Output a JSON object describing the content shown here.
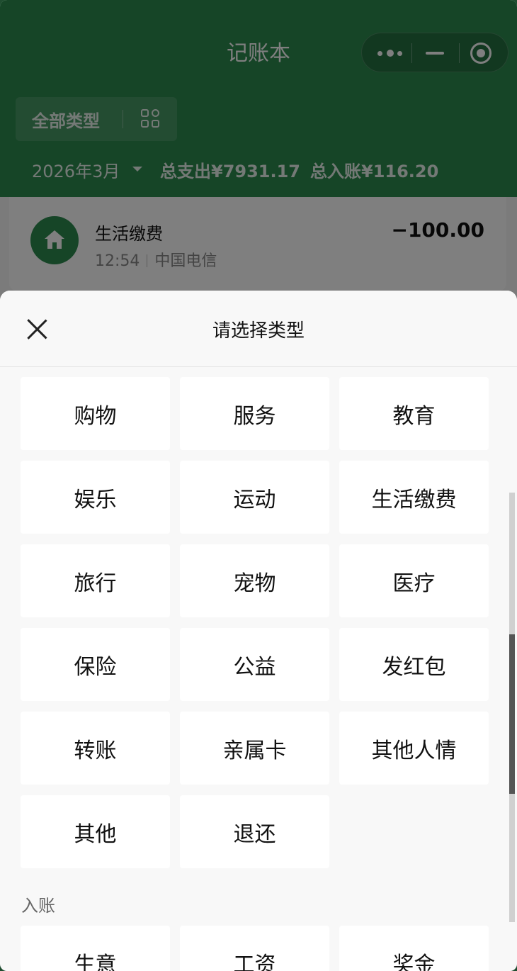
{
  "app": {
    "title": "记账本",
    "type_filter": "全部类型",
    "month": "2026年3月",
    "total_expense": "总支出¥7931.17",
    "total_income": "总入账¥116.20"
  },
  "record": {
    "category": "生活缴费",
    "time": "12:54",
    "merchant": "中国电信",
    "amount": "−100.00",
    "icon": "home-icon"
  },
  "sheet": {
    "title": "请选择类型",
    "expense_categories": [
      "购物",
      "服务",
      "教育",
      "娱乐",
      "运动",
      "生活缴费",
      "旅行",
      "宠物",
      "医疗",
      "保险",
      "公益",
      "发红包",
      "转账",
      "亲属卡",
      "其他人情",
      "其他",
      "退还"
    ],
    "income_label": "入账",
    "income_categories": [
      "生意",
      "工资",
      "奖金"
    ]
  },
  "colors": {
    "brand_green": "#2d8a4f",
    "sheet_bg": "#f8f8f8"
  }
}
